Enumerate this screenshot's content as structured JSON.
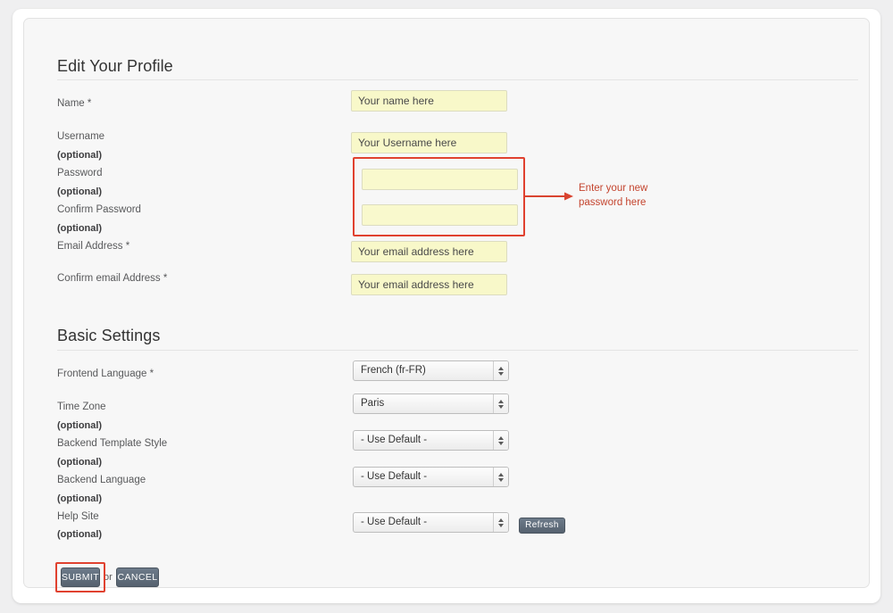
{
  "page": {
    "sections": [
      {
        "title": "Edit Your Profile"
      },
      {
        "title": "Basic Settings"
      }
    ]
  },
  "profile_fields": [
    {
      "label": "Name *",
      "optional": "",
      "value": "Your name here",
      "type": "text"
    },
    {
      "label": "Username",
      "optional": "(optional)",
      "value": "Your Username here",
      "type": "text"
    },
    {
      "label": "Password",
      "optional": "(optional)",
      "value": "",
      "type": "password"
    },
    {
      "label": "Confirm Password",
      "optional": "(optional)",
      "value": "",
      "type": "password"
    },
    {
      "label": "Email Address *",
      "optional": "",
      "value": "Your email address here",
      "type": "text"
    },
    {
      "label": "Confirm email Address *",
      "optional": "",
      "value": "Your email address here",
      "type": "text"
    }
  ],
  "settings_fields": [
    {
      "label": "Frontend Language *",
      "optional": "",
      "value": "French (fr-FR)"
    },
    {
      "label": "Time Zone",
      "optional": "(optional)",
      "value": "Paris"
    },
    {
      "label": "Backend Template Style",
      "optional": "(optional)",
      "value": "- Use Default -"
    },
    {
      "label": "Backend Language",
      "optional": "(optional)",
      "value": "- Use Default -"
    },
    {
      "label": "Help Site",
      "optional": "(optional)",
      "value": "- Use Default -"
    }
  ],
  "buttons": {
    "refresh": "Refresh",
    "submit": "SUBMIT",
    "cancel": "CANCEL",
    "or": "or"
  },
  "annotations": {
    "password_note": "Enter your new password here",
    "highlight_color": "#e0412f",
    "note_text_color": "#c4452f"
  }
}
